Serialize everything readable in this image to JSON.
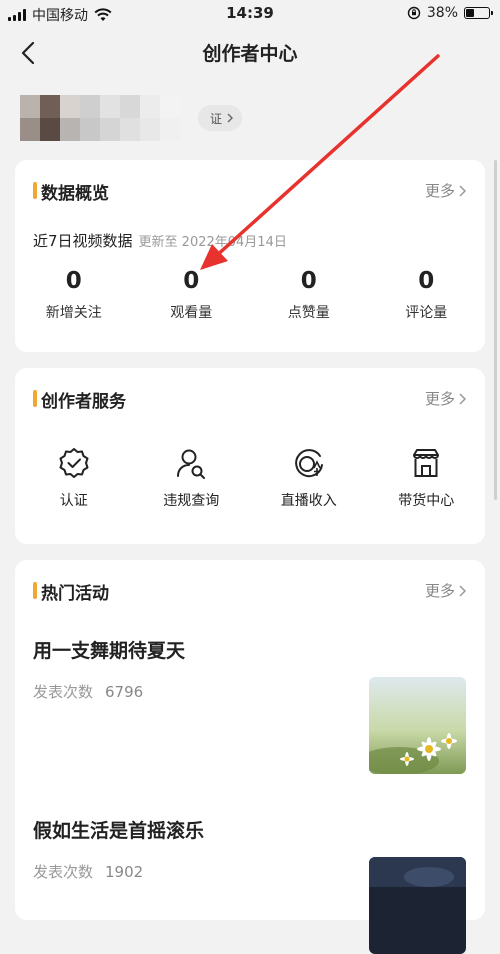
{
  "status_bar": {
    "carrier": "中国移动",
    "time": "14:39",
    "battery": "38%"
  },
  "nav": {
    "title": "创作者中心"
  },
  "profile": {
    "verify_text": "证"
  },
  "data_overview": {
    "title": "数据概览",
    "more": "更多",
    "subtitle": "近7日视频数据",
    "updated": "更新至 2022年04月14日",
    "stats": [
      {
        "value": "0",
        "label": "新增关注"
      },
      {
        "value": "0",
        "label": "观看量"
      },
      {
        "value": "0",
        "label": "点赞量"
      },
      {
        "value": "0",
        "label": "评论量"
      }
    ]
  },
  "creator_services": {
    "title": "创作者服务",
    "more": "更多",
    "items": [
      {
        "label": "认证",
        "icon": "verified-badge-icon"
      },
      {
        "label": "违规查询",
        "icon": "user-search-icon"
      },
      {
        "label": "直播收入",
        "icon": "live-income-icon"
      },
      {
        "label": "带货中心",
        "icon": "store-icon"
      }
    ]
  },
  "hot_activities": {
    "title": "热门活动",
    "more": "更多",
    "items": [
      {
        "title": "用一支舞期待夏天",
        "meta_label": "发表次数",
        "count": "6796"
      },
      {
        "title": "假如生活是首摇滚乐",
        "meta_label": "发表次数",
        "count": "1902"
      }
    ]
  },
  "colors": {
    "accent": "#f0a830",
    "annotation_arrow": "#e8322d"
  }
}
